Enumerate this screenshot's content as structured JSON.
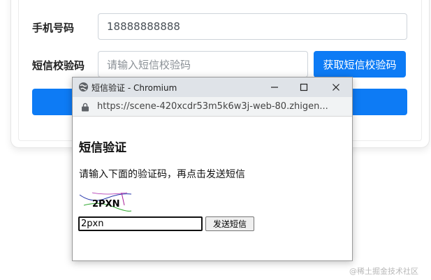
{
  "form": {
    "phone_label": "手机号码",
    "phone_value": "18888888888",
    "sms_label": "短信校验码",
    "sms_placeholder": "请输入短信校验码",
    "get_code_button": "获取短信校验码"
  },
  "popup": {
    "window_title": "短信验证 - Chromium",
    "url": "https://scene-420xcdr53m5k6w3j-web-80.zhigen...",
    "heading": "短信验证",
    "instruction": "请输入下面的验证码，再点击发送短信",
    "captcha_text": "2PXN",
    "code_input_value": "2pxn",
    "send_button": "发送短信"
  },
  "watermark": "@稀土掘金技术社区",
  "colors": {
    "primary": "#0d7bf5",
    "titlebar": "#dfe3e8"
  }
}
